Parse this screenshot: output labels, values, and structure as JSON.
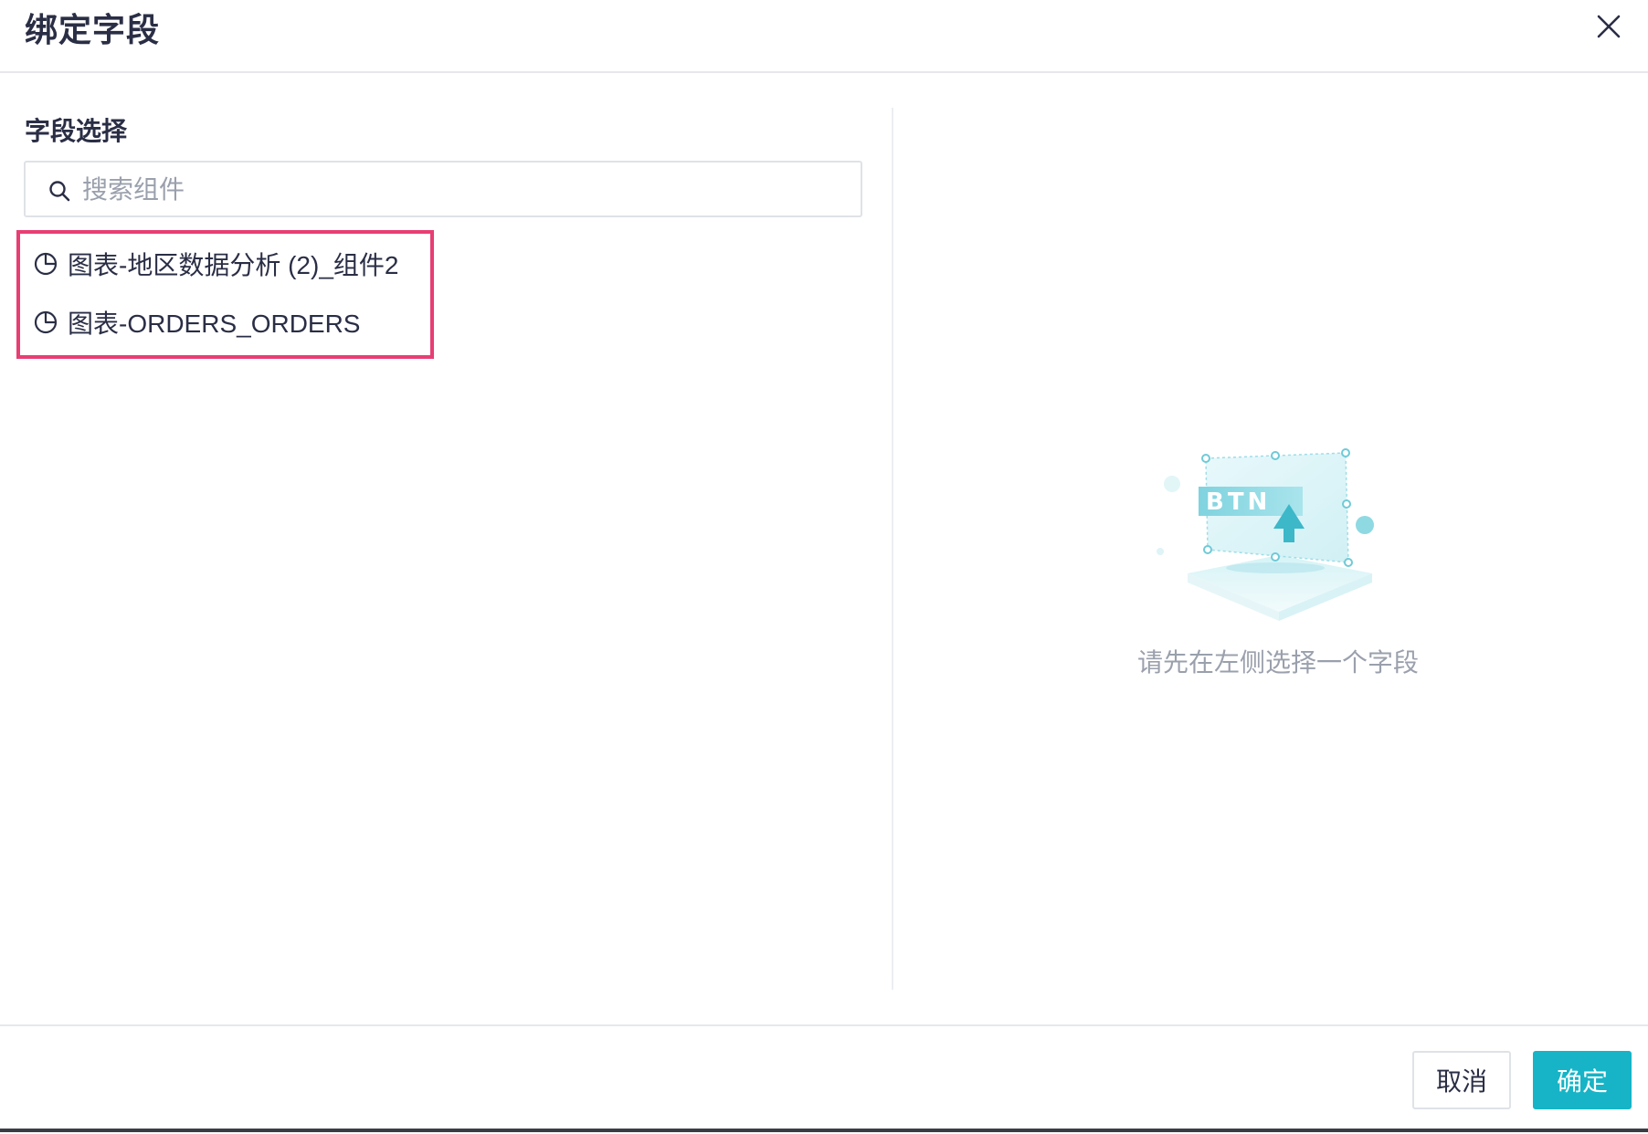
{
  "dialog": {
    "title": "绑定字段"
  },
  "left_panel": {
    "section_title": "字段选择",
    "search": {
      "placeholder": "搜索组件",
      "value": ""
    },
    "fields": [
      {
        "label": "图表-地区数据分析 (2)_组件2",
        "icon": "pie-chart-icon"
      },
      {
        "label": "图表-ORDERS_ORDERS",
        "icon": "pie-chart-icon"
      }
    ]
  },
  "right_panel": {
    "illustration_text": "BTN",
    "empty_message": "请先在左侧选择一个字段"
  },
  "footer": {
    "cancel_label": "取消",
    "ok_label": "确定"
  },
  "colors": {
    "primary": "#16b4c6",
    "highlight": "#e83e74",
    "title_text": "#2a2e45",
    "muted_text": "#9aa0ac"
  }
}
